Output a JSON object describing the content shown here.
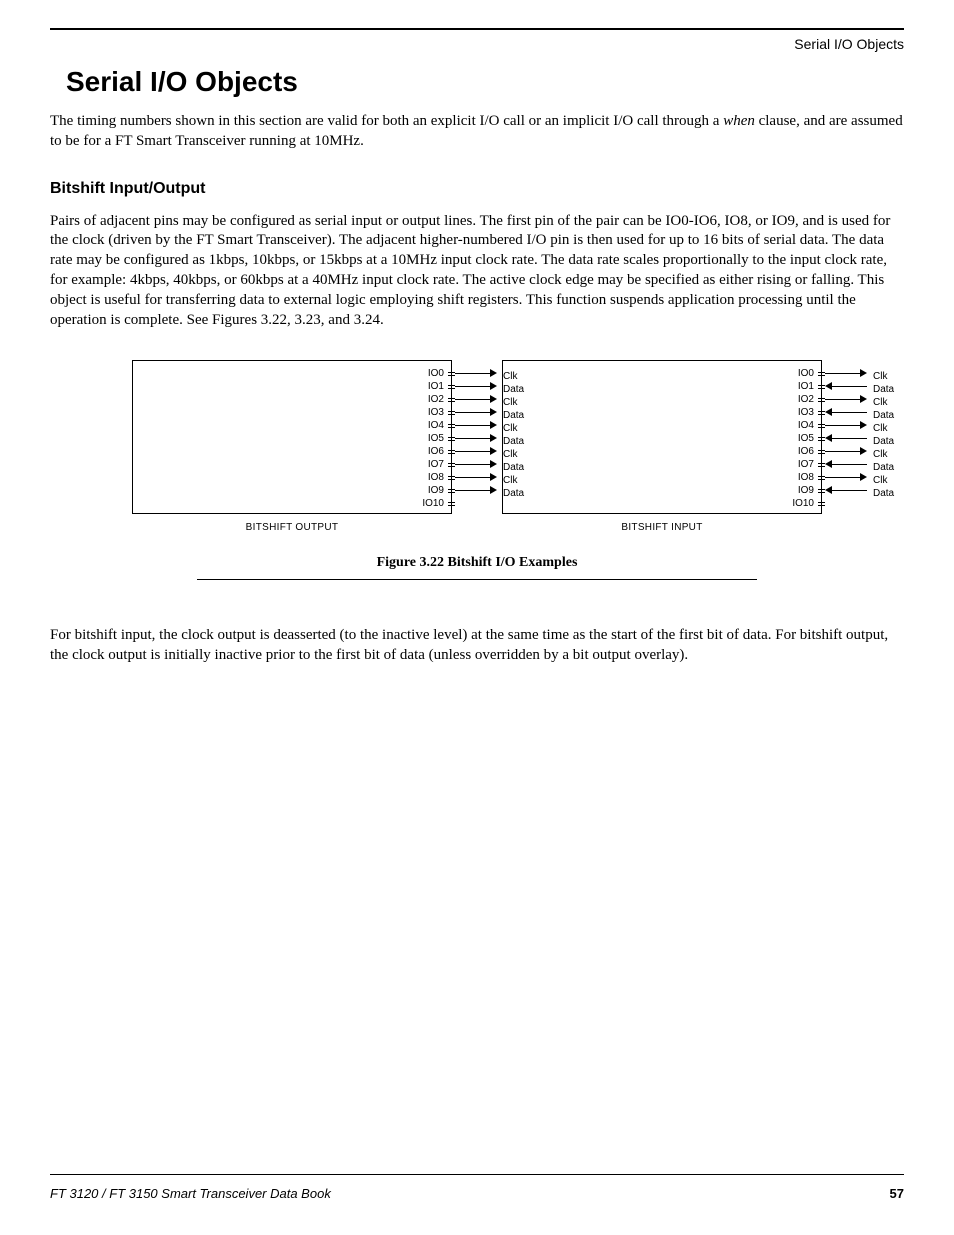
{
  "running_head": "Serial I/O Objects",
  "title": "Serial I/O Objects",
  "intro_pre": "The timing numbers shown in this section are valid for both an explicit I/O call or an implicit I/O call through a ",
  "intro_em": "when",
  "intro_post": " clause, and are assumed to be for a FT Smart Transceiver running at 10MHz.",
  "subsection": "Bitshift Input/Output",
  "para1": "Pairs of adjacent pins may be configured as serial input or output lines. The first pin of the pair can be IO0-IO6, IO8, or IO9, and is used for the clock (driven by the FT Smart Transceiver). The adjacent higher-numbered I/O pin is then used for up to 16 bits of serial data. The data rate may be configured as 1kbps, 10kbps, or 15kbps at a 10MHz input clock rate. The data rate scales proportionally to the input clock rate, for example: 4kbps, 40kbps, or 60kbps at a 40MHz input clock rate. The active clock edge may be specified as either rising or falling. This object is useful for transferring data to external logic employing shift registers. This function suspends application processing until the operation is complete. See Figures 3.22, 3.23, and 3.24.",
  "figure": {
    "pins": [
      "IO0",
      "IO1",
      "IO2",
      "IO3",
      "IO4",
      "IO5",
      "IO6",
      "IO7",
      "IO8",
      "IO9",
      "IO10"
    ],
    "output": {
      "caption": "BITSHIFT OUTPUT",
      "signals": [
        {
          "pin": "IO0",
          "label": "Clk",
          "dir": "out"
        },
        {
          "pin": "IO1",
          "label": "Data",
          "dir": "out"
        },
        {
          "pin": "IO2",
          "label": "Clk",
          "dir": "out"
        },
        {
          "pin": "IO3",
          "label": "Data",
          "dir": "out"
        },
        {
          "pin": "IO4",
          "label": "Clk",
          "dir": "out"
        },
        {
          "pin": "IO5",
          "label": "Data",
          "dir": "out"
        },
        {
          "pin": "IO6",
          "label": "Clk",
          "dir": "out"
        },
        {
          "pin": "IO7",
          "label": "Data",
          "dir": "out"
        },
        {
          "pin": "IO8",
          "label": "Clk",
          "dir": "out"
        },
        {
          "pin": "IO9",
          "label": "Data",
          "dir": "out"
        }
      ]
    },
    "input": {
      "caption": "BITSHIFT INPUT",
      "signals": [
        {
          "pin": "IO0",
          "label": "Clk",
          "dir": "out"
        },
        {
          "pin": "IO1",
          "label": "Data",
          "dir": "in"
        },
        {
          "pin": "IO2",
          "label": "Clk",
          "dir": "out"
        },
        {
          "pin": "IO3",
          "label": "Data",
          "dir": "in"
        },
        {
          "pin": "IO4",
          "label": "Clk",
          "dir": "out"
        },
        {
          "pin": "IO5",
          "label": "Data",
          "dir": "in"
        },
        {
          "pin": "IO6",
          "label": "Clk",
          "dir": "out"
        },
        {
          "pin": "IO7",
          "label": "Data",
          "dir": "in"
        },
        {
          "pin": "IO8",
          "label": "Clk",
          "dir": "out"
        },
        {
          "pin": "IO9",
          "label": "Data",
          "dir": "in"
        }
      ]
    },
    "caption": "Figure 3.22  Bitshift I/O Examples"
  },
  "para2": "For bitshift input, the clock output is deasserted (to the inactive level) at the same time as the start of the first bit of data. For bitshift output, the clock output is initially inactive prior to the first bit of data (unless overridden by a bit output overlay).",
  "footer_left": "FT 3120 / FT 3150 Smart Transceiver Data Book",
  "footer_right": "57"
}
